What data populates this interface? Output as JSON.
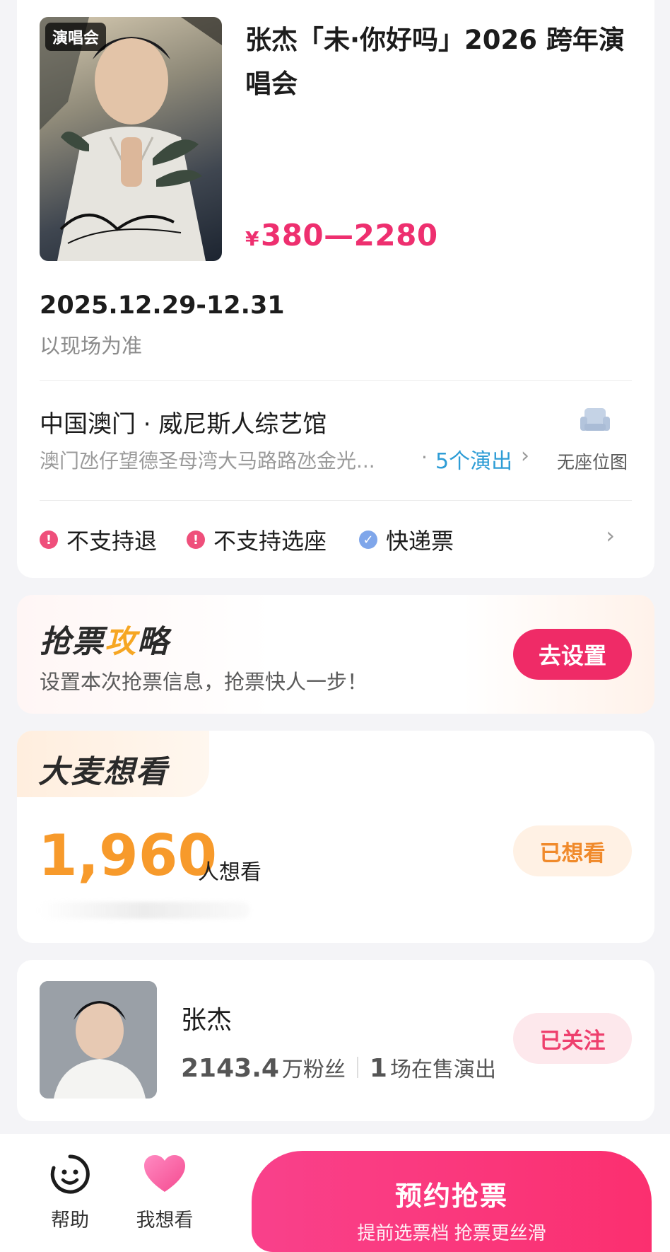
{
  "show": {
    "tag": "演唱会",
    "title": "张杰「未·你好吗」2026 跨年演唱会",
    "price_currency": "¥",
    "price_range": "380—2280",
    "date": "2025.12.29-12.31",
    "date_note": "以现场为准",
    "venue_name": "中国澳门 · 威尼斯人综艺馆",
    "venue_address": "澳门氹仔望德圣母湾大马路路氹金光...",
    "venue_sep": "·",
    "shows_link": "5个演出",
    "seat_map_label": "无座位图",
    "features": [
      "不支持退",
      "不支持选座",
      "快递票"
    ]
  },
  "strategy": {
    "title_part1": "抢票",
    "title_bolt": "攻",
    "title_part2": "略",
    "subtitle": "设置本次抢票信息，抢票快人一步！",
    "button": "去设置"
  },
  "want": {
    "title_part1": "大麦想",
    "title_part2": "看",
    "count": "1,960",
    "unit": "人想看",
    "button": "已想看"
  },
  "artist": {
    "name": "张杰",
    "fans_num": "2143.4",
    "fans_unit": "万粉丝",
    "shows_num": "1",
    "shows_unit": "场在售演出",
    "button": "已关注"
  },
  "bottom": {
    "help_label": "帮助",
    "want_label": "我想看",
    "reserve_main": "预约抢票",
    "reserve_sub": "提前选票档 抢票更丝滑"
  },
  "colors": {
    "accent": "#ef2b67",
    "price": "#ee2f6f",
    "want_count": "#f79a2b",
    "link": "#2e9dd6"
  },
  "icons": [
    "seat-map-icon",
    "warning-icon",
    "check-icon",
    "chevron-right-icon",
    "help-face-icon",
    "heart-icon"
  ]
}
